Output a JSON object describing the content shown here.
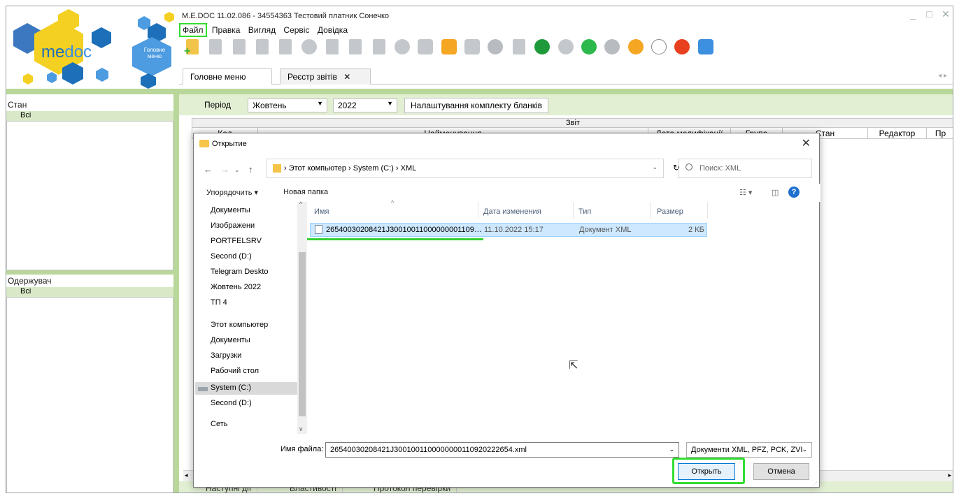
{
  "app": {
    "title": "M.E.DOC 11.02.086  - 34554363 Тестовий платник Сонечко",
    "logo_text_me": "me",
    "logo_text_doc": "doc",
    "main_menu_badge": "Головне меню"
  },
  "menubar": {
    "items": [
      "Файл",
      "Правка",
      "Вигляд",
      "Сервіс",
      "Довідка"
    ]
  },
  "tabs": {
    "main": "Головне меню",
    "registry": "Реєстр звітів",
    "registry_close": "✕"
  },
  "left": {
    "state_header": "Стан",
    "state_all": "Всі",
    "recipient_header": "Одержувач",
    "recipient_all": "Всі"
  },
  "filters": {
    "period_label": "Період",
    "month": "Жовтень",
    "year": "2022",
    "settings_button": "Налаштування комплекту бланків"
  },
  "table": {
    "group_header": "Звіт",
    "columns": [
      "Код",
      "Найменування",
      "Дата модифікації",
      "Група",
      "Стан",
      "Редактор",
      "Пр"
    ]
  },
  "bottom_tabs": [
    "Наступні дії",
    "Властивості",
    "Протокол перевірки"
  ],
  "dialog": {
    "title": "Открытие",
    "breadcrumb": [
      "Этот компьютер",
      "System (C:)",
      "XML"
    ],
    "search_placeholder": "Поиск: XML",
    "organize": "Упорядочить ▾",
    "new_folder": "Новая папка",
    "nav_items": [
      "Документы",
      "Изображени",
      "PORTFELSRV",
      "Second (D:)",
      "Telegram Deskto",
      "Жовтень 2022",
      "ТП 4",
      "Этот компьютер",
      "Документы",
      "Загрузки",
      "Рабочий стол",
      "System (C:)",
      "Second (D:)",
      "Сеть"
    ],
    "file_columns": [
      "Имя",
      "Дата изменения",
      "Тип",
      "Размер"
    ],
    "file": {
      "name": "26540030208421J30010011000000001109…",
      "date": "11.10.2022 15:17",
      "type": "Документ XML",
      "size": "2 КБ"
    },
    "filename_label": "Имя файла:",
    "filename_value": "26540030208421J3001001100000000110920222654.xml",
    "filetype": "Документи XML, PFZ, PCK, ZVI",
    "open_button": "Открыть",
    "cancel_button": "Отмена"
  },
  "colors": {
    "accent_green": "#33dd33",
    "panel_green": "#b9d79a",
    "light_green": "#e2efd3",
    "selection": "#cde8ff"
  }
}
